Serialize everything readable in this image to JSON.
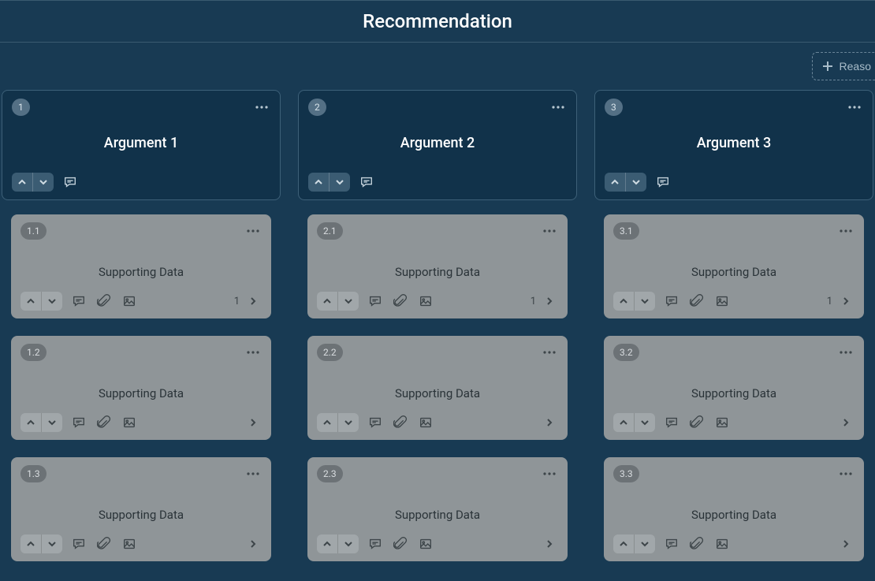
{
  "header": {
    "title": "Recommendation"
  },
  "toolbar": {
    "addReasonLabel": "Reaso"
  },
  "columns": [
    {
      "badge": "1",
      "title": "Argument 1",
      "subs": [
        {
          "badge": "1.1",
          "title": "Supporting Data",
          "count": "1"
        },
        {
          "badge": "1.2",
          "title": "Supporting Data",
          "count": ""
        },
        {
          "badge": "1.3",
          "title": "Supporting Data",
          "count": ""
        }
      ]
    },
    {
      "badge": "2",
      "title": "Argument 2",
      "subs": [
        {
          "badge": "2.1",
          "title": "Supporting Data",
          "count": "1"
        },
        {
          "badge": "2.2",
          "title": "Supporting Data",
          "count": ""
        },
        {
          "badge": "2.3",
          "title": "Supporting Data",
          "count": ""
        }
      ]
    },
    {
      "badge": "3",
      "title": "Argument 3",
      "subs": [
        {
          "badge": "3.1",
          "title": "Supporting Data",
          "count": "1"
        },
        {
          "badge": "3.2",
          "title": "Supporting Data",
          "count": ""
        },
        {
          "badge": "3.3",
          "title": "Supporting Data",
          "count": ""
        }
      ]
    }
  ]
}
